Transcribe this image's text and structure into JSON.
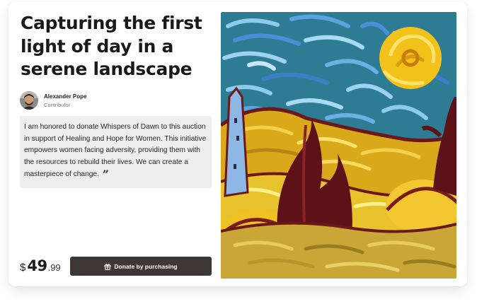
{
  "listing": {
    "title": "Capturing the first light of day in a serene landscape",
    "author": {
      "name": "Alexander Pope",
      "role": "Contributor"
    },
    "quote": "I am honored to donate Whispers of Dawn to this auction in support of Healing and Hope for Women. This initiative empowers women facing adversity, providing them with the resources to rebuild their lives. We can create a masterpiece of change.",
    "quote_mark": "”",
    "price": {
      "currency": "$",
      "amount": "49",
      "cents": ".99"
    },
    "donate_label": "Donate by purchasing"
  },
  "icons": {
    "donate": "gift-icon",
    "quote": "quote-icon"
  },
  "colors": {
    "button": "#3f3733",
    "quote_bg": "#eeeeee",
    "sky": "#2d7c94",
    "sun": "#f2c21b",
    "hills": "#e0b71e",
    "tree": "#5e1117"
  }
}
